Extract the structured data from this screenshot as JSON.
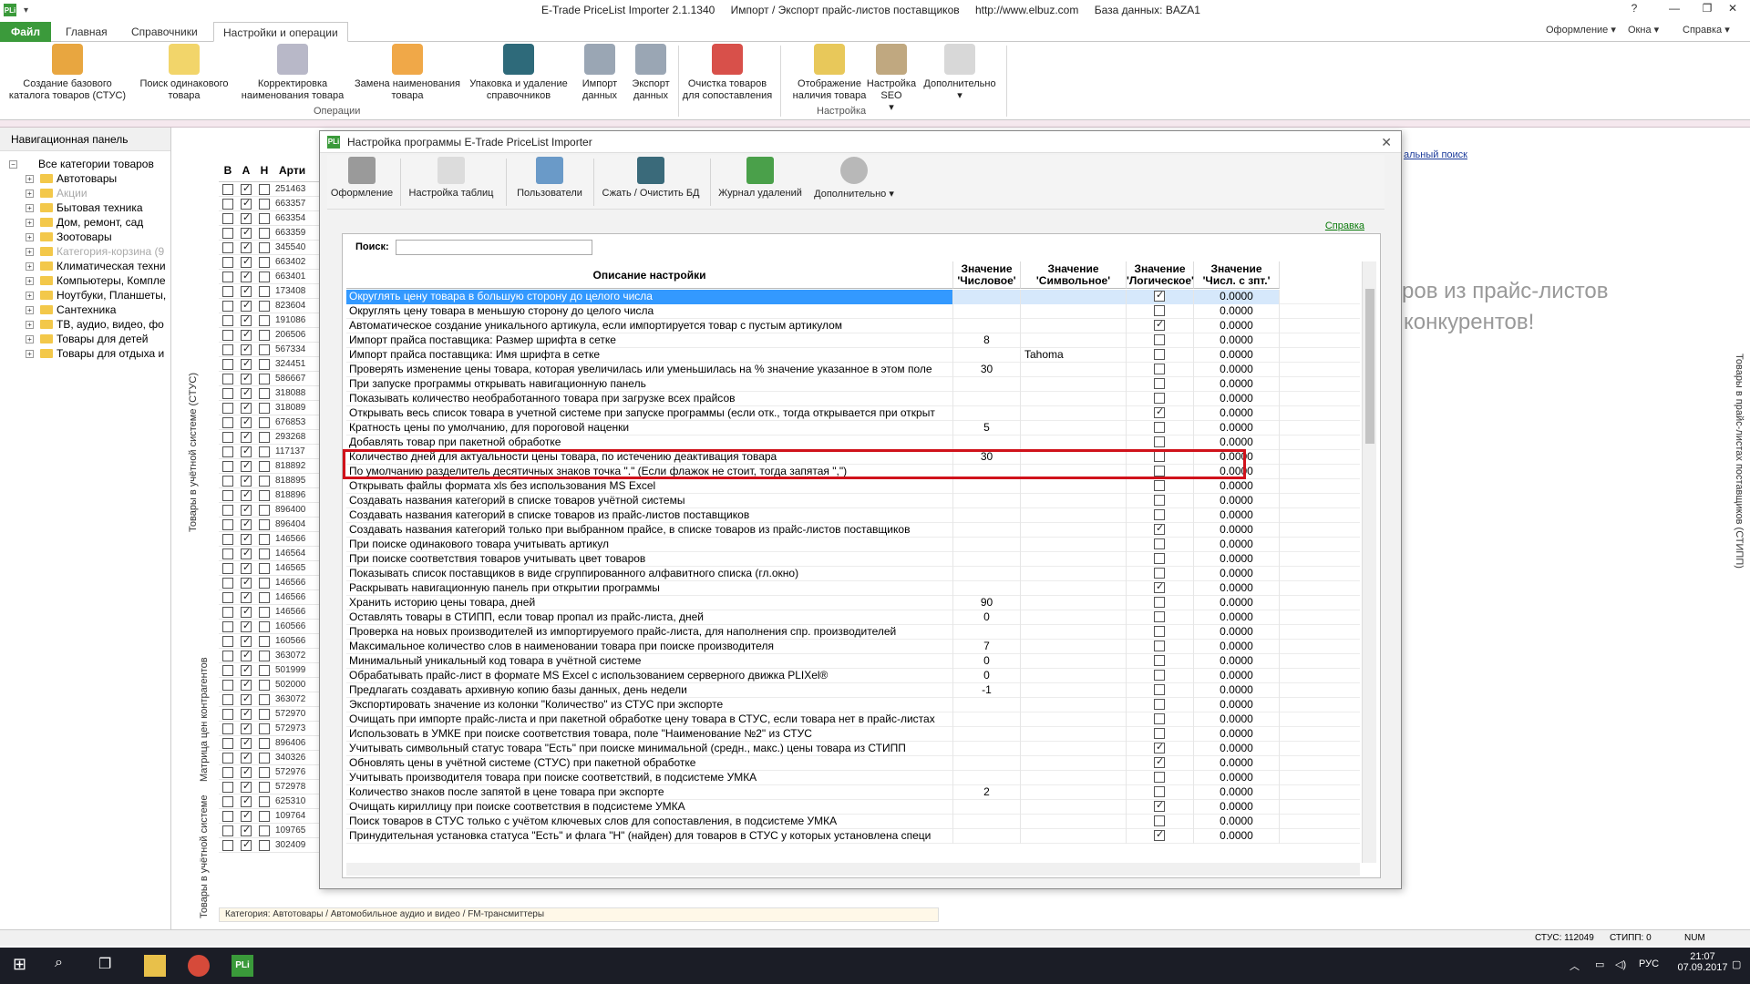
{
  "titlebar": {
    "app": "E-Trade PriceList Importer 2.1.1340",
    "subtitle": "Импорт / Экспорт прайс-листов поставщиков",
    "url": "http://www.elbuz.com",
    "db": "База данных: BAZA1"
  },
  "ribbon_tabs": {
    "file": "Файл",
    "home": "Главная",
    "refs": "Справочники",
    "settings_ops": "Настройки и операции",
    "style": "Оформление",
    "windows": "Окна",
    "help": "Справка"
  },
  "ribbon": {
    "b1": "Создание базового каталога товаров (СТУС)",
    "b2": "Поиск одинакового товара",
    "b3": "Корректировка наименования товара",
    "b4": "Замена наименования товара",
    "b5": "Упаковка и удаление справочников",
    "b6": "Импорт данных",
    "b7": "Экспорт данных",
    "b8": "Очистка товаров для сопоставления",
    "b9": "Отображение наличия товара",
    "b10": "Настройка SEO",
    "b11": "Дополнительно",
    "group_ops": "Операции",
    "group_settings": "Настройка"
  },
  "nav": {
    "header": "Навигационная панель",
    "items": [
      {
        "label": "Все категории товаров",
        "root": true
      },
      {
        "label": "Автотовары"
      },
      {
        "label": "Акции",
        "disabled": true
      },
      {
        "label": "Бытовая техника"
      },
      {
        "label": "Дом, ремонт, сад"
      },
      {
        "label": "Зоотовары"
      },
      {
        "label": "Категория-корзина (9",
        "disabled": true
      },
      {
        "label": "Климатическая техни"
      },
      {
        "label": "Компьютеры, Компле"
      },
      {
        "label": "Ноутбуки, Планшеты,"
      },
      {
        "label": "Сантехника"
      },
      {
        "label": "ТВ, аудио, видео, фо"
      },
      {
        "label": "Товары для детей"
      },
      {
        "label": "Товары для отдыха и"
      }
    ]
  },
  "leftgrid": {
    "headers": [
      "В",
      "А",
      "Н",
      "Арти"
    ],
    "rows": [
      "251463",
      "663357",
      "663354",
      "663359",
      "345540",
      "663402",
      "663401",
      "173408",
      "823604",
      "191086",
      "206506",
      "567334",
      "324451",
      "586667",
      "318088",
      "318089",
      "676853",
      "293268",
      "117137",
      "818892",
      "818895",
      "818896",
      "896400",
      "896404",
      "146566",
      "146564",
      "146565",
      "146566",
      "146566",
      "146566",
      "160566",
      "160566",
      "363072",
      "501999",
      "502000",
      "363072",
      "572970",
      "572973",
      "896406",
      "340326",
      "572976",
      "572978",
      "625310",
      "109764",
      "109765",
      "302409"
    ]
  },
  "side_labels": {
    "left1": "Товары в учётной системе (СТУС)",
    "left2": "Матрица цен контрагентов",
    "left3": "Товары в учётной системе",
    "right": "Товары в прайс-листах поставщиков (СТИПП)"
  },
  "dialog": {
    "title": "Настройка программы E-Trade PriceList Importer",
    "toolbar": [
      "Оформление",
      "Настройка таблиц",
      "Пользователи",
      "Сжать / Очистить БД",
      "Журнал удалений",
      "Дополнительно"
    ],
    "help": "Справка",
    "search_label": "Поиск:",
    "search_value": "",
    "headers": {
      "desc": "Описание настройки",
      "num": "Значение 'Числовое'",
      "sym": "Значение 'Символьное'",
      "bool": "Значение 'Логическое'",
      "dec": "Значение 'Числ. с зпт.'"
    },
    "rows": [
      {
        "d": "Округлять цену товара в большую сторону до целого числа",
        "n": "",
        "s": "",
        "b": true,
        "v": "0.0000"
      },
      {
        "d": "Округлять цену товара в меньшую сторону до целого числа",
        "n": "",
        "s": "",
        "b": false,
        "v": "0.0000"
      },
      {
        "d": "Автоматическое создание уникального артикула, если импортируется товар с пустым артикулом",
        "n": "",
        "s": "",
        "b": true,
        "v": "0.0000"
      },
      {
        "d": "Импорт прайса поставщика: Размер шрифта в сетке",
        "n": "8",
        "s": "",
        "b": false,
        "v": "0.0000"
      },
      {
        "d": "Импорт прайса поставщика: Имя шрифта в сетке",
        "n": "",
        "s": "Tahoma",
        "b": false,
        "v": "0.0000"
      },
      {
        "d": "Проверять изменение цены товара, которая увеличилась или уменьшилась на % значение указанное в этом поле",
        "n": "30",
        "s": "",
        "b": false,
        "v": "0.0000"
      },
      {
        "d": "При запуске программы открывать навигационную панель",
        "n": "",
        "s": "",
        "b": false,
        "v": "0.0000"
      },
      {
        "d": "Показывать количество необработанного товара при загрузке всех прайсов",
        "n": "",
        "s": "",
        "b": false,
        "v": "0.0000"
      },
      {
        "d": "Открывать весь список товара в учетной системе при запуске программы (если отк., тогда открывается при открыт",
        "n": "",
        "s": "",
        "b": true,
        "v": "0.0000"
      },
      {
        "d": "Кратность цены по умолчанию, для пороговой наценки",
        "n": "5",
        "s": "",
        "b": false,
        "v": "0.0000"
      },
      {
        "d": "Добавлять товар при пакетной обработке",
        "n": "",
        "s": "",
        "b": false,
        "v": "0.0000"
      },
      {
        "d": "Количество дней для актуальности цены товара, по истечению деактивация товара",
        "n": "30",
        "s": "",
        "b": false,
        "v": "0.0000"
      },
      {
        "d": "По умолчанию разделитель десятичных знаков точка \".\" (Если флажок не стоит, тогда запятая \",\")",
        "n": "",
        "s": "",
        "b": false,
        "v": "0.0000"
      },
      {
        "d": "Открывать файлы формата xls без использования MS Excel",
        "n": "",
        "s": "",
        "b": false,
        "v": "0.0000"
      },
      {
        "d": "Создавать названия категорий в списке товаров учётной системы",
        "n": "",
        "s": "",
        "b": false,
        "v": "0.0000"
      },
      {
        "d": "Создавать названия категорий в списке товаров из прайс-листов поставщиков",
        "n": "",
        "s": "",
        "b": false,
        "v": "0.0000"
      },
      {
        "d": "Создавать названия категорий только при выбранном прайсе, в списке товаров из прайс-листов поставщиков",
        "n": "",
        "s": "",
        "b": true,
        "v": "0.0000"
      },
      {
        "d": "При поиске одинакового товара учитывать артикул",
        "n": "",
        "s": "",
        "b": false,
        "v": "0.0000"
      },
      {
        "d": "При поиске соответствия товаров учитывать цвет товаров",
        "n": "",
        "s": "",
        "b": false,
        "v": "0.0000"
      },
      {
        "d": "Показывать список поставщиков в виде сгруппированного алфавитного списка (гл.окно)",
        "n": "",
        "s": "",
        "b": false,
        "v": "0.0000"
      },
      {
        "d": "Раскрывать навигационную панель при открытии программы",
        "n": "",
        "s": "",
        "b": true,
        "v": "0.0000"
      },
      {
        "d": "Хранить историю цены товара, дней",
        "n": "90",
        "s": "",
        "b": false,
        "v": "0.0000"
      },
      {
        "d": "Оставлять товары в СТИПП, если товар пропал из прайс-листа, дней",
        "n": "0",
        "s": "",
        "b": false,
        "v": "0.0000"
      },
      {
        "d": "Проверка на новых производителей из импортируемого прайс-листа, для наполнения спр. производителей",
        "n": "",
        "s": "",
        "b": false,
        "v": "0.0000"
      },
      {
        "d": "Максимальное количество слов в наименовании товара при поиске производителя",
        "n": "7",
        "s": "",
        "b": false,
        "v": "0.0000"
      },
      {
        "d": "Минимальный уникальный код товара в учётной системе",
        "n": "0",
        "s": "",
        "b": false,
        "v": "0.0000"
      },
      {
        "d": "Обрабатывать прайс-лист в формате MS Excel с использованием серверного движка PLIXel®",
        "n": "0",
        "s": "",
        "b": false,
        "v": "0.0000"
      },
      {
        "d": "Предлагать создавать архивную копию базы данных, день недели",
        "n": "-1",
        "s": "",
        "b": false,
        "v": "0.0000"
      },
      {
        "d": "Экспортировать значение из колонки \"Количество\" из СТУС при экспорте",
        "n": "",
        "s": "",
        "b": false,
        "v": "0.0000"
      },
      {
        "d": "Очищать при импорте прайс-листа и при пакетной обработке цену товара в СТУС, если товара нет в прайс-листах",
        "n": "",
        "s": "",
        "b": false,
        "v": "0.0000"
      },
      {
        "d": "Использовать в УМКЕ при поиске соответствия товара, поле \"Наименование №2\" из СТУС",
        "n": "",
        "s": "",
        "b": false,
        "v": "0.0000"
      },
      {
        "d": "Учитывать символьный статус товара \"Есть\" при поиске минимальной (средн., макс.) цены товара из СТИПП",
        "n": "",
        "s": "",
        "b": true,
        "v": "0.0000"
      },
      {
        "d": "Обновлять цены в учётной системе (СТУС) при пакетной обработке",
        "n": "",
        "s": "",
        "b": true,
        "v": "0.0000"
      },
      {
        "d": "Учитывать производителя товара при поиске соответствий, в подсистеме УМКА",
        "n": "",
        "s": "",
        "b": false,
        "v": "0.0000"
      },
      {
        "d": "Количество знаков после запятой в цене товара при экспорте",
        "n": "2",
        "s": "",
        "b": false,
        "v": "0.0000"
      },
      {
        "d": "Очищать кириллицу при поиске соответствия в подсистеме УМКА",
        "n": "",
        "s": "",
        "b": true,
        "v": "0.0000"
      },
      {
        "d": "Поиск товаров в СТУС только с учётом ключевых слов для сопоставления, в подсистеме УМКА",
        "n": "",
        "s": "",
        "b": false,
        "v": "0.0000"
      },
      {
        "d": "Принудительная установка статуса \"Есть\" и флага \"Н\" (найден) для товаров в СТУС у которых установлена специ",
        "n": "",
        "s": "",
        "b": true,
        "v": "0.0000"
      }
    ]
  },
  "right_area": {
    "link": "альный поиск",
    "text1": "ров из прайс-листов",
    "text2": "конкурентов!"
  },
  "pathbar": "Категория: Автотовары / Автомобильное аудио и видео / FM-трансмиттеры",
  "status": {
    "stus": "СТУС: 112049",
    "stipp": "СТИПП: 0",
    "num": "NUM"
  },
  "taskbar": {
    "lang": "РУС",
    "time": "21:07",
    "date": "07.09.2017"
  }
}
